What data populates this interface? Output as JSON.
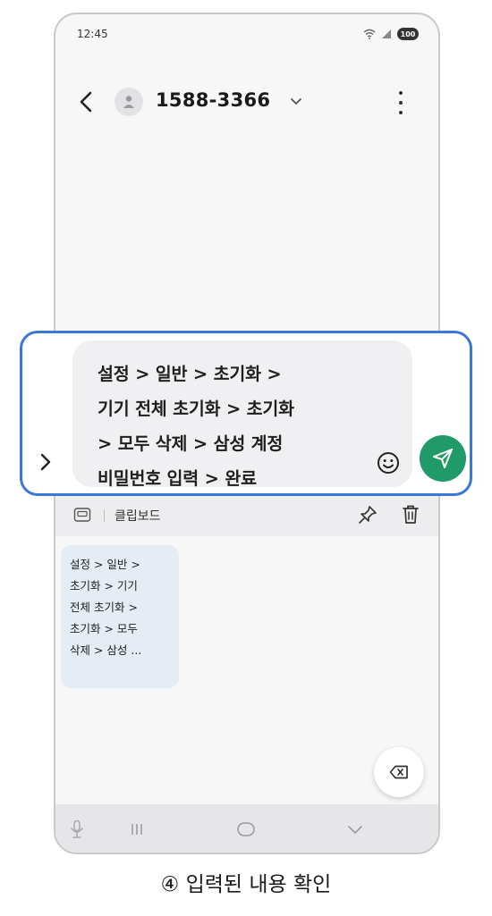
{
  "status_bar": {
    "time": "12:45",
    "battery": "100"
  },
  "header": {
    "contact": "1588-3366"
  },
  "message_input": {
    "text": "설정 > 일반 > 초기화 >\n기기 전체 초기화 > 초기화\n> 모두 삭제 > 삼성 계정\n비밀번호 입력 > 완료"
  },
  "clipboard": {
    "label": "클립보드",
    "items": [
      {
        "text": "설정 > 일반 >\n초기화 > 기기\n전체 초기화 >\n초기화 > 모두\n삭제 > 삼성 ..."
      }
    ]
  },
  "caption": "④ 입력된 내용 확인",
  "icons": {
    "back": "chevron-left-icon",
    "avatar": "person-icon",
    "more": "more-vertical-icon",
    "expand": "chevron-right-icon",
    "emoji": "smiley-icon",
    "send": "send-icon",
    "keyboard": "keyboard-icon",
    "pin": "pin-icon",
    "delete": "trash-icon",
    "backspace": "backspace-icon",
    "mic": "mic-icon",
    "recents": "recents-icon",
    "home": "home-icon",
    "hide_keyboard": "chevron-down-icon"
  },
  "colors": {
    "accent": "#3a77d8",
    "send": "#1f9a68",
    "clip_card": "#e6ecf4"
  }
}
